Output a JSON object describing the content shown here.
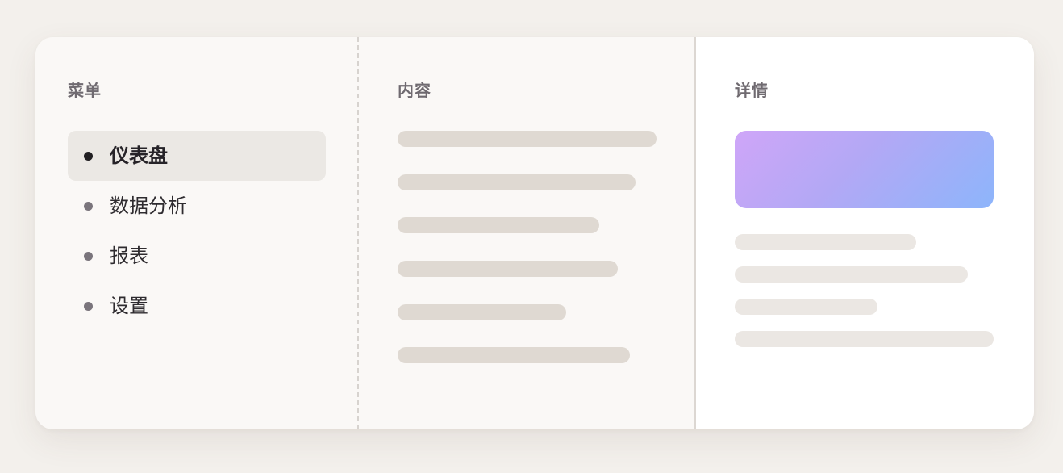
{
  "colors": {
    "page_background": "#f3f0ec",
    "card_background": "#faf8f6",
    "detail_background": "#ffffff",
    "active_item_background": "#ebe8e4",
    "skeleton_content": "#dfd9d2",
    "skeleton_detail": "#ebe7e3",
    "gradient_start": "#cfa6f8",
    "gradient_end": "#8db5fb"
  },
  "menu": {
    "title": "菜单",
    "items": [
      {
        "label": "仪表盘",
        "active": true,
        "icon": "bullet-dot-icon"
      },
      {
        "label": "数据分析",
        "active": false,
        "icon": "bullet-dot-icon"
      },
      {
        "label": "报表",
        "active": false,
        "icon": "bullet-dot-icon"
      },
      {
        "label": "设置",
        "active": false,
        "icon": "bullet-dot-icon"
      }
    ]
  },
  "content": {
    "title": "内容",
    "placeholder_line_count": 6
  },
  "detail": {
    "title": "详情",
    "hero_placeholder": "gradient-image-placeholder",
    "placeholder_line_count": 4
  }
}
